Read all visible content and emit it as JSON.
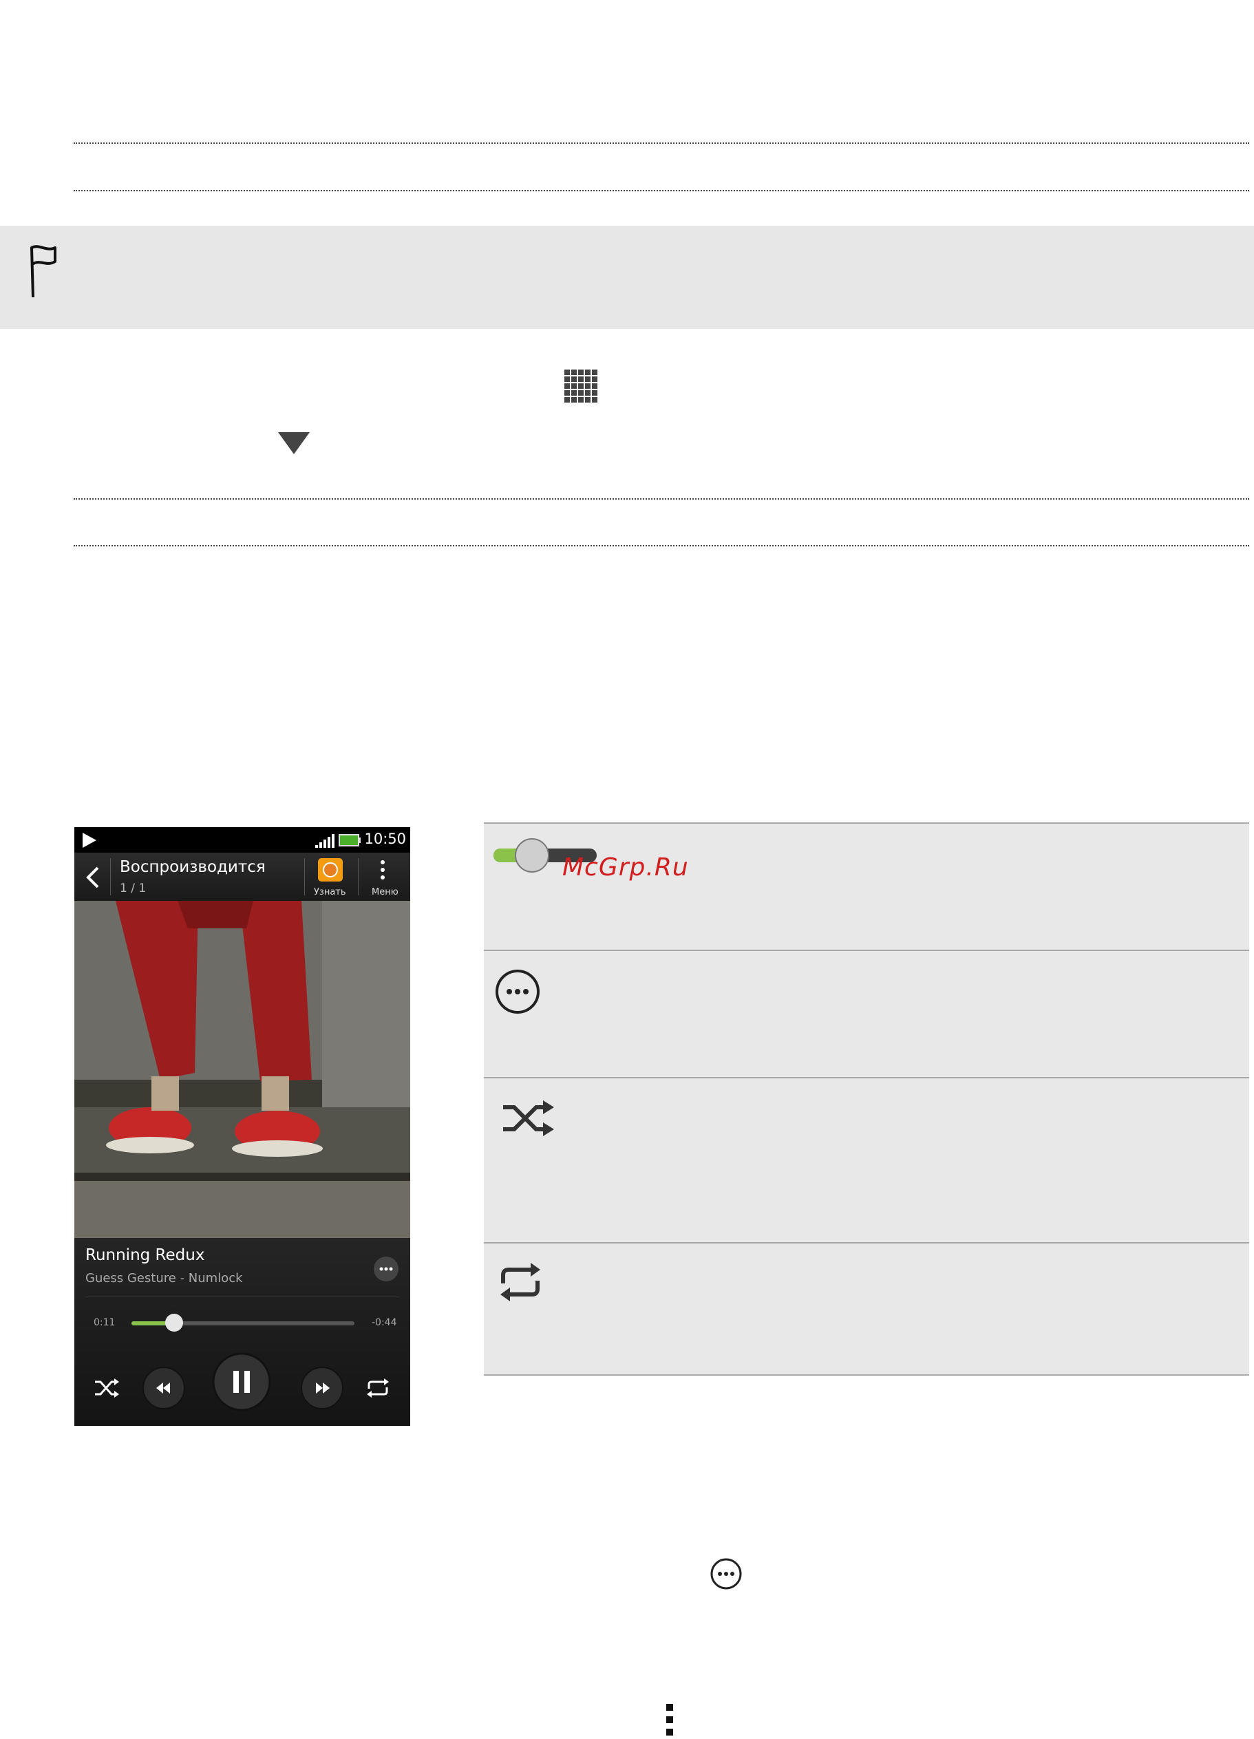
{
  "phone": {
    "status_time": "10:50",
    "title": "Воспроизводится",
    "subtitle": "1 / 1",
    "learn_label": "Узнать",
    "menu_label": "Меню",
    "song_title": "Running Redux",
    "song_artist": "Guess Gesture - Numlock",
    "elapsed": "0:11",
    "remaining": "-0:44",
    "progress_fraction": 0.19
  },
  "watermark": "McGrp.Ru",
  "icons": {
    "note": "flag-icon",
    "apps": "apps-grid-icon",
    "dropdown": "triangle-down-icon",
    "slider": "slider-icon",
    "more": "more-options-icon",
    "shuffle": "shuffle-icon",
    "repeat": "repeat-icon",
    "menu": "menu-dots-icon"
  },
  "colors": {
    "note_bg": "#e7e7e7",
    "table_bg": "#e8e8e8",
    "accent_green": "#8bc34a",
    "watermark_red": "#d21e1e"
  }
}
